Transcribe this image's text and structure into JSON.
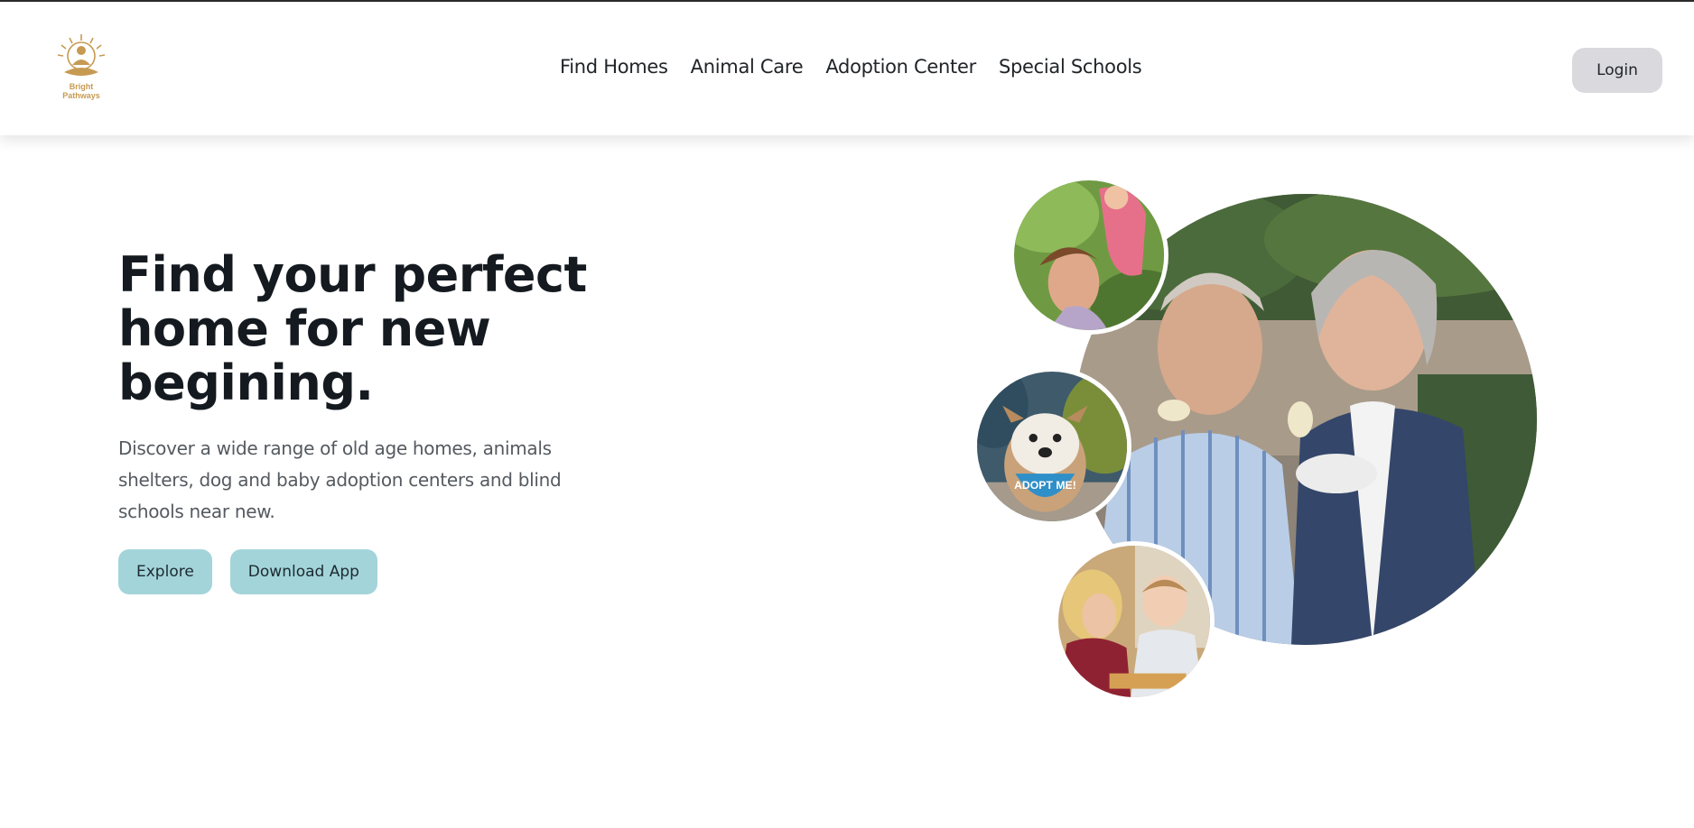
{
  "brand": {
    "logo_text": "Bright Pathways",
    "logo_icon": "sun-meditating-figure-logo",
    "accent_color": "#c79a52"
  },
  "nav": {
    "items": [
      {
        "label": "Find Homes"
      },
      {
        "label": "Animal Care"
      },
      {
        "label": "Adoption Center"
      },
      {
        "label": "Special Schools"
      }
    ],
    "login_label": "Login"
  },
  "hero": {
    "title": "Find your perfect home for new begining.",
    "description": "Discover a wide range of old age homes, animals shelters, dog and baby adoption centers and blind schools near new.",
    "explore_label": "Explore",
    "download_label": "Download App",
    "button_color": "#a3d4da"
  },
  "collage": {
    "photos": [
      {
        "name": "elderly-couple-photo"
      },
      {
        "name": "mother-baby-photo"
      },
      {
        "name": "adopt-me-dog-photo",
        "caption": "ADOPT ME!"
      },
      {
        "name": "children-classroom-photo"
      }
    ]
  }
}
